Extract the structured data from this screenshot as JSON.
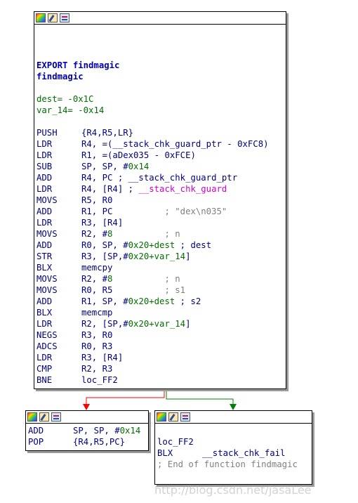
{
  "main_block": {
    "header": [
      "EXPORT findmagic",
      "findmagic"
    ],
    "vars": [
      {
        "name": "dest",
        "value": "= -0x1C"
      },
      {
        "name": "var_14",
        "value": "= -0x14"
      }
    ],
    "instructions": [
      {
        "m": "PUSH",
        "a": "{R4,R5,LR}"
      },
      {
        "m": "LDR",
        "a": "R4, =(__stack_chk_guard_ptr - 0xFC8)"
      },
      {
        "m": "LDR",
        "a": "R1, =(aDex035 - 0xFCE)"
      },
      {
        "m": "SUB",
        "a": "SP, SP, #",
        "n": "0x14"
      },
      {
        "m": "ADD",
        "a": "R4, PC ; __stack_chk_guard_ptr"
      },
      {
        "m": "LDR",
        "a": "R4, [R4] ; ",
        "sym": "__stack_chk_guard"
      },
      {
        "m": "MOVS",
        "a": "R5, R0"
      },
      {
        "m": "ADD",
        "a": "R1, PC",
        "c": "          ; \"dex\\n035\""
      },
      {
        "m": "LDR",
        "a": "R3, [R4]"
      },
      {
        "m": "MOVS",
        "a": "R2, #",
        "n": "8",
        "c": "          ; n"
      },
      {
        "m": "ADD",
        "a": "R0, SP, #",
        "n": "0x20+dest",
        "t": " ; dest"
      },
      {
        "m": "STR",
        "a": "R3, [SP,#",
        "n": "0x20+var_14",
        "t": "]"
      },
      {
        "m": "BLX",
        "a": "memcpy"
      },
      {
        "m": "MOVS",
        "a": "R2, #",
        "n": "8",
        "c": "          ; n"
      },
      {
        "m": "MOVS",
        "a": "R0, R5",
        "c": "          ; s1"
      },
      {
        "m": "ADD",
        "a": "R1, SP, #",
        "n": "0x20+dest",
        "t": " ; s2"
      },
      {
        "m": "BLX",
        "a": "memcmp"
      },
      {
        "m": "LDR",
        "a": "R2, [SP,#",
        "n": "0x20+var_14",
        "t": "]"
      },
      {
        "m": "NEGS",
        "a": "R3, R0"
      },
      {
        "m": "ADCS",
        "a": "R0, R3"
      },
      {
        "m": "LDR",
        "a": "R3, [R4]"
      },
      {
        "m": "CMP",
        "a": "R2, R3"
      },
      {
        "m": "BNE",
        "a": "loc_FF2"
      }
    ]
  },
  "left_block": {
    "instructions": [
      {
        "m": "ADD",
        "a": "SP, SP, #",
        "n": "0x14"
      },
      {
        "m": "POP",
        "a": "{R4,R5,PC}"
      }
    ]
  },
  "right_block": {
    "label": "loc_FF2",
    "call": {
      "m": "BLX",
      "a": "__stack_chk_fail"
    },
    "comment": "; End of function findmagic"
  },
  "edges": {
    "false_color": "#ff0000",
    "true_color": "#008000"
  },
  "icons": [
    "graph-overview-icon",
    "edit-icon",
    "xrefs-icon"
  ],
  "watermark": "http://blog.csdn.net/jasaLee"
}
